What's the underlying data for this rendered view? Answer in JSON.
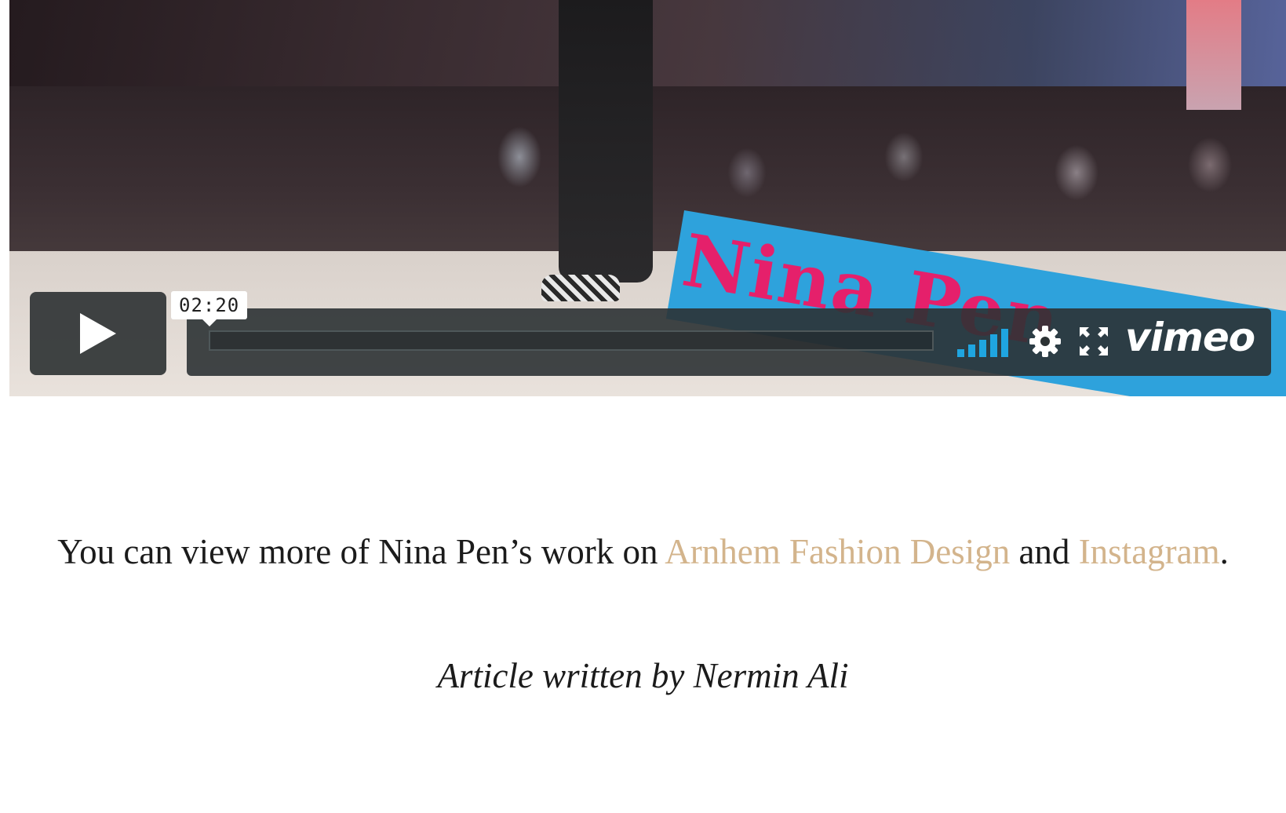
{
  "video": {
    "banner_text": "Nina Pen",
    "time_tooltip": "02:20",
    "brand": "vimeo",
    "accent_color": "#1fa5e0",
    "banner_color": "#2ea2dc",
    "banner_text_color": "#e5206b",
    "icons": [
      "play-icon",
      "volume-icon",
      "gear-icon",
      "fullscreen-icon"
    ]
  },
  "article": {
    "caption_prefix": "You can view more of Nina Pen’s work on ",
    "link1": "Arnhem Fashion Design",
    "caption_middle": " and ",
    "link2": "Instagram",
    "caption_suffix": ".",
    "link_color": "#d3b48c",
    "author": "Article written by Nermin Ali"
  }
}
